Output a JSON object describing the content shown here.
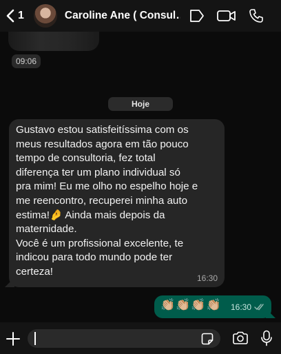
{
  "header": {
    "back_count": "1",
    "contact_name": "Caroline Ane ( Consul…"
  },
  "chat": {
    "image_time": "09:06",
    "day_label": "Hoje",
    "incoming": {
      "text": "Gustavo estou satisfeitíssima com os\nmeus resultados agora em tão pouco\ntempo de consultoria, fez total\ndiferença ter um plano individual só\npra mim! Eu me olho no espelho hoje e\nme reencontro, recuperei minha auto\nestima!🤌 Ainda mais depois da\nmaternidade.\nVocê é um profissional excelente, te\nindicou para todo mundo pode ter\ncerteza!",
      "time": "16:30"
    },
    "outgoing": {
      "text": "👏🏼👏🏼👏🏼👏🏼",
      "time": "16:30",
      "status": "read"
    }
  },
  "colors": {
    "outgoing_bubble": "#005c4b",
    "incoming_bubble": "#262626",
    "read_ticks": "#8fb7ae"
  },
  "icons": [
    "chevron-left-icon",
    "tag-icon",
    "video-camera-icon",
    "phone-icon",
    "plus-icon",
    "sticker-icon",
    "camera-icon",
    "microphone-icon"
  ]
}
